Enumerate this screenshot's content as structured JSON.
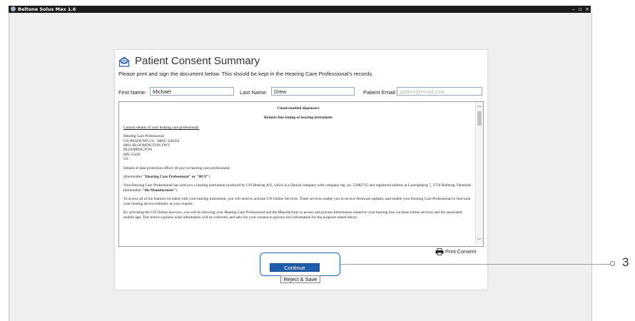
{
  "window": {
    "title": "Beltone Solus Max 1.6",
    "controls": {
      "minimize": "–",
      "maximize": "▫",
      "close": "×"
    }
  },
  "consent": {
    "heading": "Patient Consent Summary",
    "subheading": "Please print and sign the document below. This should be kept in the Hearing Care Professional's records.",
    "first_name_label": "First Name:",
    "first_name_value": "Michael",
    "last_name_label": "Last Name:",
    "last_name_value": "Drew",
    "email_label": "Patient Email:",
    "email_placeholder": "patient@email.com"
  },
  "document": {
    "title": "Cloud-enabled dispensers",
    "subtitle": "Remote fine tuning of hearing instrument",
    "contact_heading": "Contact details of your hearing care professional:",
    "address_lines": [
      "Hearing Care Professional",
      "GN RESOUND US - MISC SALES",
      "8001 BLOOMINGTON FWY",
      "BLOOMINGTON",
      "MN 55420",
      "US"
    ],
    "dpo_line": "Details of data protection officer (if any) at hearing care professional:",
    "hcp_pre": "(Hereinafter ",
    "hcp_bold": "\"Hearing Care Professional\" or \"HCP\"",
    "hcp_post": ")",
    "para1_pre": "Your Hearing Care Professional has sold you a hearing instrument produced by GN Hearing A/S, which is a Danish company with company reg. no. 55082715 and registered address at Lautrupbjerg 7, 2750 Ballerup, Denmark (hereinafter ",
    "para1_bold": "\"the Manufacturer\"",
    "para1_post": ")",
    "para2": "To access all of the features included with your hearing instrument, you will need to activate GN Online Services. These services enable you to receive firmware updates, and enable your Hearing Care Professional to fine-tune your hearing device remotely at your request.",
    "para3": "By activating the GN Online Services, you will be allowing your Hearing Care Professional and the Manufacturer to access and process information related to your hearing loss via these online services and the associated mobile app. This notice explains what information will be collected, and asks for your consent to process this information for the purposes stated below."
  },
  "actions": {
    "print_label": "Print Consent",
    "continue_label": "Continue",
    "reject_label": "Reject & Save"
  },
  "callout": {
    "number": "3"
  }
}
